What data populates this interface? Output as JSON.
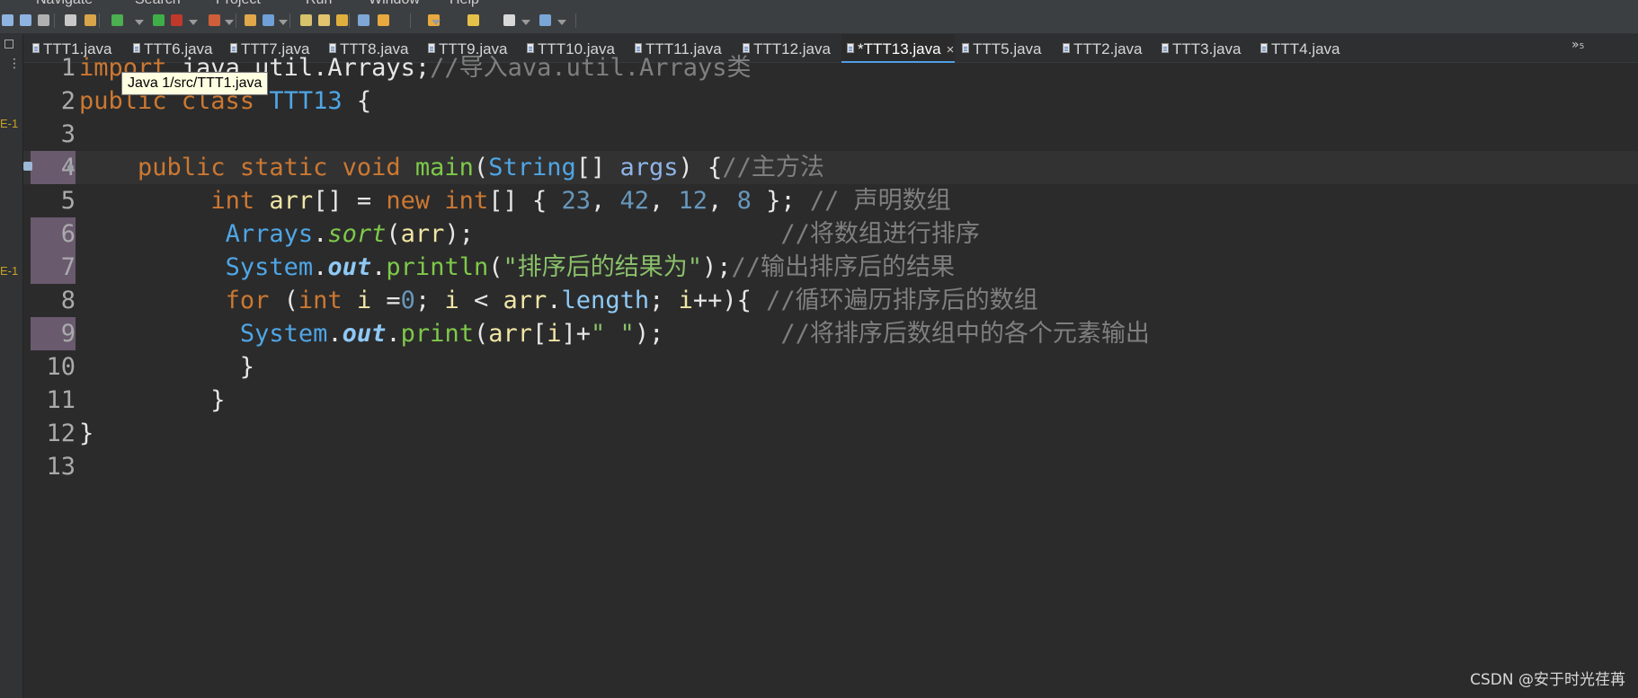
{
  "menubar": {
    "items": [
      "Navigate",
      "Search",
      "Project",
      "Run",
      "Window",
      "Help"
    ]
  },
  "toolbar": {
    "icons": [
      "undo-icon",
      "redo-icon",
      "last-edit-icon",
      "new-icon",
      "build-icon",
      "debug-icon",
      "run-icon",
      "coverage-icon",
      "external-tools-icon",
      "open-type-icon",
      "open-task-icon",
      "search-icon",
      "annotation-icon",
      "toggle-mark-icon",
      "show-whitespace-icon",
      "next-annotation-icon",
      "prev-annotation-icon",
      "back-icon",
      "forward-icon",
      "pin-editor-icon"
    ]
  },
  "left_strip": {
    "labels": [
      "E-1",
      "E-1"
    ]
  },
  "tabs": [
    {
      "label": "TTT1.java"
    },
    {
      "label": "TTT6.java"
    },
    {
      "label": "TTT7.java"
    },
    {
      "label": "TTT8.java"
    },
    {
      "label": "TTT9.java"
    },
    {
      "label": "TTT10.java"
    },
    {
      "label": "TTT11.java"
    },
    {
      "label": "TTT12.java"
    },
    {
      "label": "*TTT13.java",
      "active": true,
      "close": "×"
    },
    {
      "label": "TTT5.java"
    },
    {
      "label": "TTT2.java"
    },
    {
      "label": "TTT3.java"
    },
    {
      "label": "TTT4.java"
    }
  ],
  "tab_overflow": "»₅",
  "tooltip": "Java 1/src/TTT1.java",
  "editor": {
    "current_line": 4,
    "lines": [
      {
        "num": "1",
        "tokens": [
          [
            "kw",
            "import "
          ],
          [
            "",
            "java.util.Arrays;"
          ],
          [
            "cmt",
            "//导入ava.util.Arrays类"
          ]
        ]
      },
      {
        "num": "2",
        "tokens": [
          [
            "kw",
            "public class "
          ],
          [
            "cls",
            "TTT13"
          ],
          [
            "",
            " {"
          ]
        ]
      },
      {
        "num": "3",
        "tokens": []
      },
      {
        "num": "4",
        "bp": true,
        "tokens": [
          [
            "",
            "    "
          ],
          [
            "kw",
            "public static void "
          ],
          [
            "mth",
            "main"
          ],
          [
            "",
            "("
          ],
          [
            "cls",
            "String"
          ],
          [
            "",
            "[] "
          ],
          [
            "prm",
            "args"
          ],
          [
            "",
            ") {"
          ],
          [
            "cmt",
            "//主方法"
          ]
        ]
      },
      {
        "num": "5",
        "tokens": [
          [
            "",
            "         "
          ],
          [
            "kw",
            "int "
          ],
          [
            "var",
            "arr"
          ],
          [
            "",
            "[] = "
          ],
          [
            "kw",
            "new int"
          ],
          [
            "",
            "[] { "
          ],
          [
            "num",
            "23"
          ],
          [
            "",
            ", "
          ],
          [
            "num",
            "42"
          ],
          [
            "",
            ", "
          ],
          [
            "num",
            "12"
          ],
          [
            "",
            ", "
          ],
          [
            "num",
            "8"
          ],
          [
            "",
            " }; "
          ],
          [
            "cmt",
            "// 声明数组"
          ]
        ]
      },
      {
        "num": "6",
        "bp": true,
        "tokens": [
          [
            "",
            "          "
          ],
          [
            "cls",
            "Arrays"
          ],
          [
            "",
            "."
          ],
          [
            "smth",
            "sort"
          ],
          [
            "",
            "("
          ],
          [
            "var",
            "arr"
          ],
          [
            "",
            ");                     "
          ],
          [
            "cmt",
            "//将数组进行排序"
          ]
        ]
      },
      {
        "num": "7",
        "bp": true,
        "tokens": [
          [
            "",
            "          "
          ],
          [
            "cls",
            "System"
          ],
          [
            "",
            "."
          ],
          [
            "sfield",
            "out"
          ],
          [
            "",
            "."
          ],
          [
            "mth",
            "println"
          ],
          [
            "",
            "("
          ],
          [
            "str",
            "\"排序后的结果为\""
          ],
          [
            "",
            ");"
          ],
          [
            "cmt",
            "//输出排序后的结果"
          ]
        ]
      },
      {
        "num": "8",
        "tokens": [
          [
            "",
            "          "
          ],
          [
            "kw",
            "for "
          ],
          [
            "",
            "("
          ],
          [
            "kw",
            "int "
          ],
          [
            "var",
            "i"
          ],
          [
            "",
            " ="
          ],
          [
            "num",
            "0"
          ],
          [
            "",
            "; "
          ],
          [
            "var",
            "i"
          ],
          [
            "",
            " < "
          ],
          [
            "var",
            "arr"
          ],
          [
            "",
            "."
          ],
          [
            "fld",
            "length"
          ],
          [
            "",
            "; "
          ],
          [
            "var",
            "i"
          ],
          [
            "",
            "++){ "
          ],
          [
            "cmt",
            "//循环遍历排序后的数组"
          ]
        ]
      },
      {
        "num": "9",
        "bp": true,
        "tokens": [
          [
            "",
            "           "
          ],
          [
            "cls",
            "System"
          ],
          [
            "",
            "."
          ],
          [
            "sfield",
            "out"
          ],
          [
            "",
            "."
          ],
          [
            "mth",
            "print"
          ],
          [
            "",
            "("
          ],
          [
            "var",
            "arr"
          ],
          [
            "",
            "["
          ],
          [
            "var",
            "i"
          ],
          [
            "",
            "]+"
          ],
          [
            "str",
            "\" \""
          ],
          [
            "",
            ");        "
          ],
          [
            "cmt",
            "//将排序后数组中的各个元素输出"
          ]
        ]
      },
      {
        "num": "10",
        "tokens": [
          [
            "",
            "           }"
          ]
        ]
      },
      {
        "num": "11",
        "tokens": [
          [
            "",
            "         }"
          ]
        ]
      },
      {
        "num": "12",
        "tokens": [
          [
            "",
            "}"
          ]
        ]
      },
      {
        "num": "13",
        "tokens": []
      }
    ]
  },
  "watermark": "CSDN @安于时光荏苒"
}
